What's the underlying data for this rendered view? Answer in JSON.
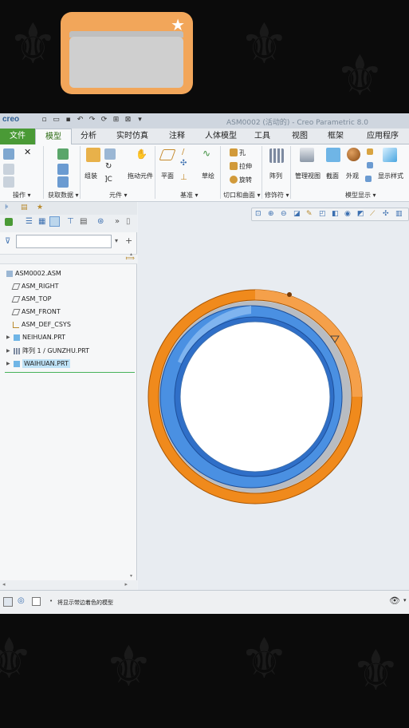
{
  "window": {
    "logo": "creo",
    "title": "ASM0002 (活动的) - Creo Parametric 8.0"
  },
  "tabs": [
    {
      "label": "文件"
    },
    {
      "label": "模型"
    },
    {
      "label": "分析"
    },
    {
      "label": "实时仿真"
    },
    {
      "label": "注释"
    },
    {
      "label": "人体模型"
    },
    {
      "label": "工具"
    },
    {
      "label": "视图"
    },
    {
      "label": "框架"
    },
    {
      "label": "应用程序"
    }
  ],
  "ribbon": {
    "buttons": {
      "assemble": "组装",
      "drag_components": "拖动元件",
      "plane": "平面",
      "sketch": "草绘",
      "hole": "孔",
      "extrude": "拉伸",
      "revolve": "旋转",
      "pattern": "阵列",
      "manage_views": "管理视图",
      "section": "截面",
      "appearance": "外观",
      "display_style": "显示样式"
    },
    "groups": {
      "operations": "操作 ▾",
      "get_data": "获取数据 ▾",
      "component": "元件 ▾",
      "datum": "基准 ▾",
      "cut_surface": "切口和曲面 ▾",
      "modifiers": "修饰符 ▾",
      "model_display": "模型显示 ▾"
    }
  },
  "tree": {
    "items": [
      {
        "label": "ASM0002.ASM"
      },
      {
        "label": "ASM_RIGHT"
      },
      {
        "label": "ASM_TOP"
      },
      {
        "label": "ASM_FRONT"
      },
      {
        "label": "ASM_DEF_CSYS"
      },
      {
        "label": "NEIHUAN.PRT"
      },
      {
        "label": "阵列 1 / GUNZHU.PRT"
      },
      {
        "label": "WAIHUAN.PRT"
      }
    ]
  },
  "status": {
    "message": "将显示带边着色的模型"
  },
  "colors": {
    "outer_ring": "#f08a1c",
    "inner_ring": "#4a90e2",
    "file_tab": "#4a9a36",
    "overlay_card": "#f2a65a"
  }
}
